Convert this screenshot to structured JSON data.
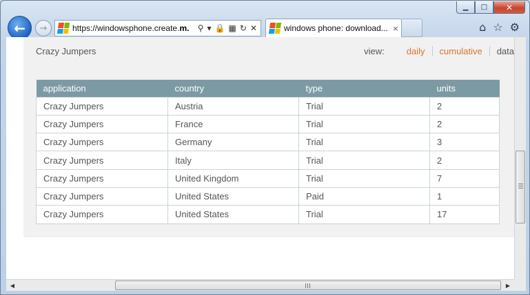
{
  "browser": {
    "address_url_prefix": "https://windowsphone.create.",
    "address_url_bold": "m.",
    "tab_title": "windows phone: download...",
    "tab_close": "×",
    "back": "←",
    "forward": "→",
    "caption": {
      "min": "▁",
      "max": "□",
      "close": "✕"
    },
    "addr_icons": [
      "⚲",
      "▾",
      "🔒",
      "▦",
      "↻",
      "✕"
    ],
    "tools": [
      "⌂",
      "☆",
      "⚙"
    ],
    "flag_colors": [
      "#f25022",
      "#7fba00",
      "#00a4ef",
      "#ffb900"
    ]
  },
  "page": {
    "app_title": "Crazy Jumpers",
    "view_label": "view:",
    "view_links": {
      "daily": "daily",
      "cumulative": "cumulative",
      "data": "data"
    },
    "accent_color": "#d9752a",
    "table": {
      "headers": [
        "application",
        "country",
        "type",
        "units"
      ],
      "rows": [
        [
          "Crazy Jumpers",
          "Austria",
          "Trial",
          "2"
        ],
        [
          "Crazy Jumpers",
          "France",
          "Trial",
          "2"
        ],
        [
          "Crazy Jumpers",
          "Germany",
          "Trial",
          "3"
        ],
        [
          "Crazy Jumpers",
          "Italy",
          "Trial",
          "2"
        ],
        [
          "Crazy Jumpers",
          "United Kingdom",
          "Trial",
          "7"
        ],
        [
          "Crazy Jumpers",
          "United States",
          "Paid",
          "1"
        ],
        [
          "Crazy Jumpers",
          "United States",
          "Trial",
          "17"
        ]
      ]
    }
  },
  "scrollbar": {
    "left_arrow": "◀",
    "right_arrow": "▶"
  }
}
